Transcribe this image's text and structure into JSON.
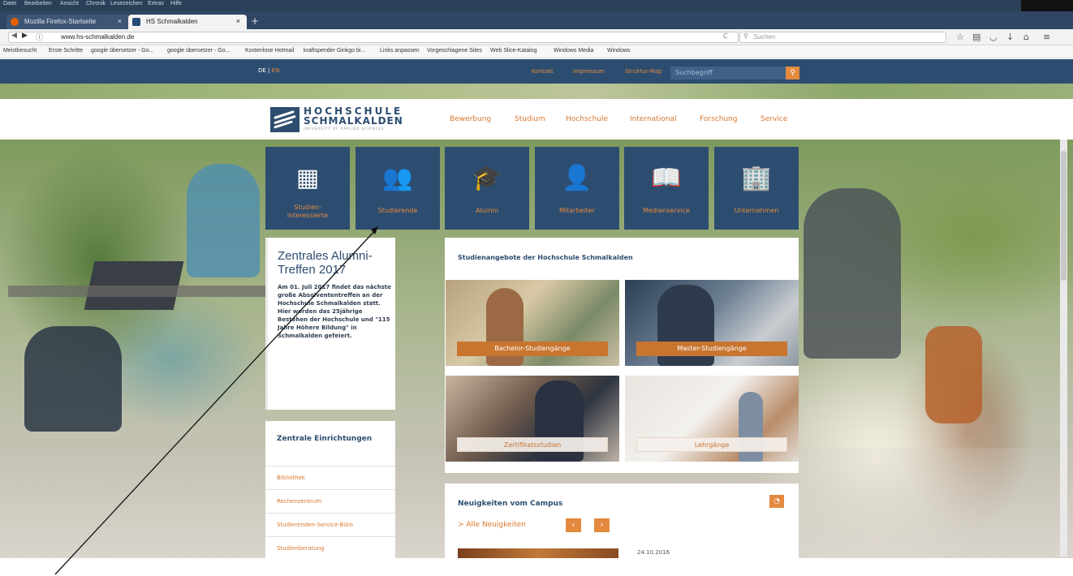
{
  "browser": {
    "menu_items": [
      "Datei",
      "Bearbeiten",
      "Ansicht",
      "Chronik",
      "Lesezeichen",
      "Extras",
      "Hilfe"
    ],
    "tabs": [
      {
        "title": "Mozilla Firefox-Startseite"
      },
      {
        "title": "HS Schmalkalden"
      }
    ],
    "url": "www.hs-schmalkalden.de",
    "search_placeholder": "Suchen",
    "bookmarks": [
      "Meistbesucht",
      "Erste Schritte",
      "google übersetzer - Go...",
      "google übersetzer - Go...",
      "Kostenlose Hotmail",
      "kraftspender Ginkgo bi...",
      "Links anpassen",
      "Vorgeschlagene Sites",
      "Web Slice-Katalog",
      "Windows Media",
      "Windows"
    ]
  },
  "site": {
    "lang": {
      "de": "DE",
      "sep": " | ",
      "en": "EN"
    },
    "top_links": [
      "Kontakt",
      "Impressum",
      "Struktur-Map"
    ],
    "search_placeholder": "Suchbegriff",
    "logo": {
      "line1": "HOCHSCHULE",
      "line2": "SCHMALKALDEN",
      "line3": "UNIVERSITY OF APPLIED SCIENCES"
    },
    "main_nav": [
      "Bewerbung",
      "Studium",
      "Hochschule",
      "International",
      "Forschung",
      "Service"
    ],
    "tiles": [
      {
        "label": "Studien-\ninteressierte",
        "icon": "info-desk-icon",
        "glyph": "▦"
      },
      {
        "label": "Studierende",
        "icon": "students-group-icon",
        "glyph": "👥"
      },
      {
        "label": "Alumni",
        "icon": "graduate-icon",
        "glyph": "🎓"
      },
      {
        "label": "Mitarbeiter",
        "icon": "staff-group-icon",
        "glyph": "👤"
      },
      {
        "label": "Medienservice",
        "icon": "reader-icon",
        "glyph": "📖"
      },
      {
        "label": "Unternehmen",
        "icon": "buildings-icon",
        "glyph": "🏢"
      }
    ],
    "news_card": {
      "title": "Zentrales Alumni-Treffen 2017",
      "text": "Am 01. Juli 2017 findet das nächste große Absolvententreffen an der Hochschule Schmalkalden statt. Hier werden das 25jährige Bestehen der Hochschule und \"115 Jahre Höhere Bildung\" in Schmalkalden gefeiert."
    },
    "facilities": {
      "title": "Zentrale Einrichtungen",
      "items": [
        "Bibliothek",
        "Rechenzentrum",
        "Studierenden-Service-Büro",
        "Studienberatung"
      ]
    },
    "study_offers": {
      "title": "Studienangebote der Hochschule Schmalkalden",
      "items": [
        "Bachelor-Studiengänge",
        "Master-Studiengänge",
        "Zertifikatsstudien",
        "Lehrgänge"
      ]
    },
    "campus_news": {
      "title": "Neuigkeiten vom Campus",
      "all_link": "> Alle Neuigkeiten",
      "prev": "‹",
      "next": "›",
      "rss": "rss-icon",
      "date": "24.10.2016"
    }
  },
  "colors": {
    "navy": "#2d4d70",
    "orange": "#e38a3f",
    "dark_orange": "#c87530"
  }
}
